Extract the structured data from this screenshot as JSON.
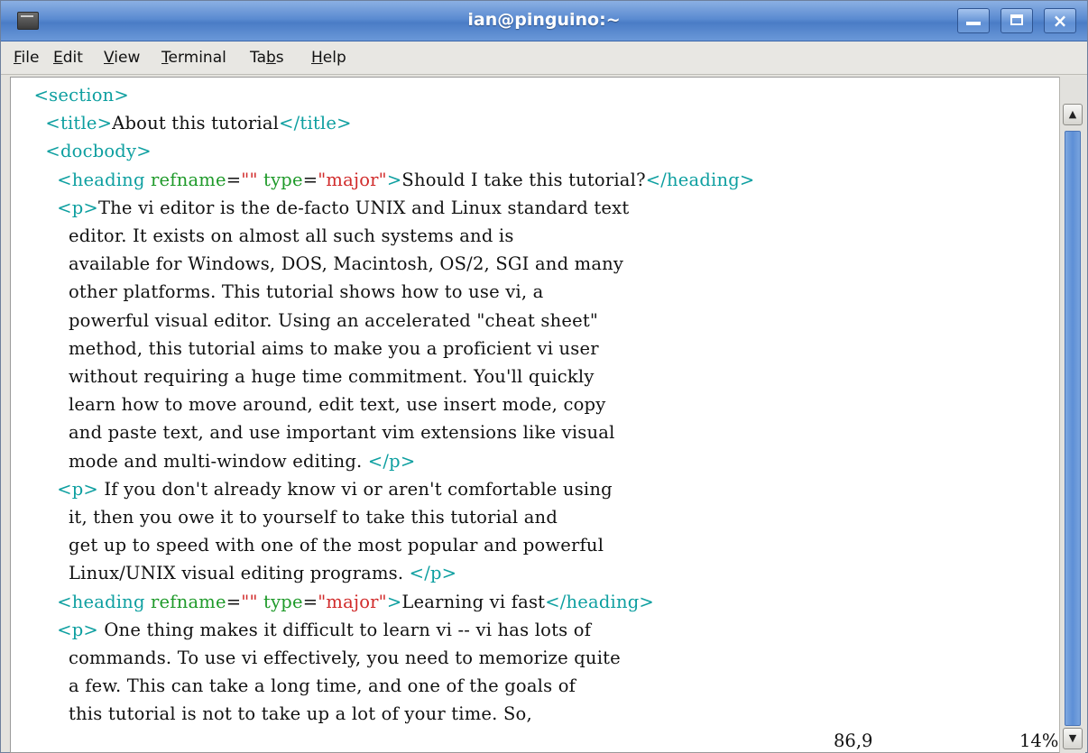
{
  "window": {
    "title": "ian@pinguino:~",
    "icon": "terminal-icon"
  },
  "window_controls": {
    "minimize_icon": "minimize-icon",
    "maximize_icon": "maximize-icon",
    "close_glyph": "×"
  },
  "menubar": {
    "items": [
      {
        "accel": "F",
        "rest": "ile"
      },
      {
        "accel": "E",
        "rest": "dit"
      },
      {
        "accel": "V",
        "rest": "iew"
      },
      {
        "accel": "T",
        "rest": "erminal"
      },
      {
        "pre": "Ta",
        "accel": "b",
        "rest": "s"
      },
      {
        "accel": "H",
        "rest": "elp"
      }
    ]
  },
  "editor": {
    "lines": [
      [
        {
          "t": "    "
        },
        {
          "c": "tag",
          "t": "<section>"
        }
      ],
      [
        {
          "t": "      "
        },
        {
          "c": "tag",
          "t": "<title>"
        },
        {
          "t": "About this tutorial"
        },
        {
          "c": "tag",
          "t": "</title>"
        }
      ],
      [
        {
          "t": "      "
        },
        {
          "c": "tag",
          "t": "<docbody>"
        }
      ],
      [
        {
          "t": "        "
        },
        {
          "c": "tag",
          "t": "<heading "
        },
        {
          "c": "attr",
          "t": "refname"
        },
        {
          "t": "="
        },
        {
          "c": "val",
          "t": "\"\""
        },
        {
          "t": " "
        },
        {
          "c": "attr",
          "t": "type"
        },
        {
          "t": "="
        },
        {
          "c": "val",
          "t": "\"major\""
        },
        {
          "c": "tag",
          "t": ">"
        },
        {
          "t": "Should I take this tutorial?"
        },
        {
          "c": "tag",
          "t": "</heading>"
        }
      ],
      [
        {
          "t": "        "
        },
        {
          "c": "tag",
          "t": "<p>"
        },
        {
          "t": "The vi editor is the de-facto UNIX and Linux standard text"
        }
      ],
      [
        {
          "t": "          editor. It exists on almost all such systems and is"
        }
      ],
      [
        {
          "t": "          available for Windows, DOS, Macintosh, OS/2, SGI and many"
        }
      ],
      [
        {
          "t": "          other platforms. This tutorial shows how to use vi, a"
        }
      ],
      [
        {
          "t": "          powerful visual editor. Using an accelerated \"cheat sheet\""
        }
      ],
      [
        {
          "t": "          method, this tutorial aims to make you a proficient vi user"
        }
      ],
      [
        {
          "t": "          without requiring a huge time commitment. You'll quickly"
        }
      ],
      [
        {
          "t": "          learn how to move around, edit text, use insert mode, copy"
        }
      ],
      [
        {
          "t": "          and paste text, and use important vim extensions like visual"
        }
      ],
      [
        {
          "t": "          mode and multi-window editing. "
        },
        {
          "c": "tag",
          "t": "</p>"
        }
      ],
      [
        {
          "t": "        "
        },
        {
          "c": "tag",
          "t": "<p>"
        },
        {
          "t": " If you don't already know vi or aren't comfortable using"
        }
      ],
      [
        {
          "t": "          it, then you owe it to yourself to take this tutorial and"
        }
      ],
      [
        {
          "t": "          get up to speed with one of the most popular and powerful"
        }
      ],
      [
        {
          "t": "          Linux/UNIX visual editing programs. "
        },
        {
          "c": "tag",
          "t": "</p>"
        }
      ],
      [
        {
          "t": "        "
        },
        {
          "c": "tag",
          "t": "<heading "
        },
        {
          "c": "attr",
          "t": "refname"
        },
        {
          "t": "="
        },
        {
          "c": "val",
          "t": "\"\""
        },
        {
          "t": " "
        },
        {
          "c": "attr",
          "t": "type"
        },
        {
          "t": "="
        },
        {
          "c": "val",
          "t": "\"major\""
        },
        {
          "c": "tag",
          "t": ">"
        },
        {
          "t": "Learning vi fast"
        },
        {
          "c": "tag",
          "t": "</heading>"
        }
      ],
      [
        {
          "t": "        "
        },
        {
          "c": "tag",
          "t": "<p>"
        },
        {
          "t": " One thing makes it difficult to learn vi -- vi has lots of"
        }
      ],
      [
        {
          "t": "          commands. To use vi effectively, you need to memorize quite"
        }
      ],
      [
        {
          "t": "          a few. This can take a long time, and one of the goals of"
        }
      ],
      [
        {
          "t": "          this tutorial is not to take up a lot of your time. So,"
        }
      ]
    ],
    "colors": {
      "tag": "#0d9fa0",
      "attr": "#1f9a2a",
      "val": "#d12b2b",
      "text": "#111111"
    }
  },
  "status": {
    "position": "86,9",
    "percent": "14%"
  },
  "scrollbar": {
    "up_glyph": "▲",
    "down_glyph": "▼"
  }
}
